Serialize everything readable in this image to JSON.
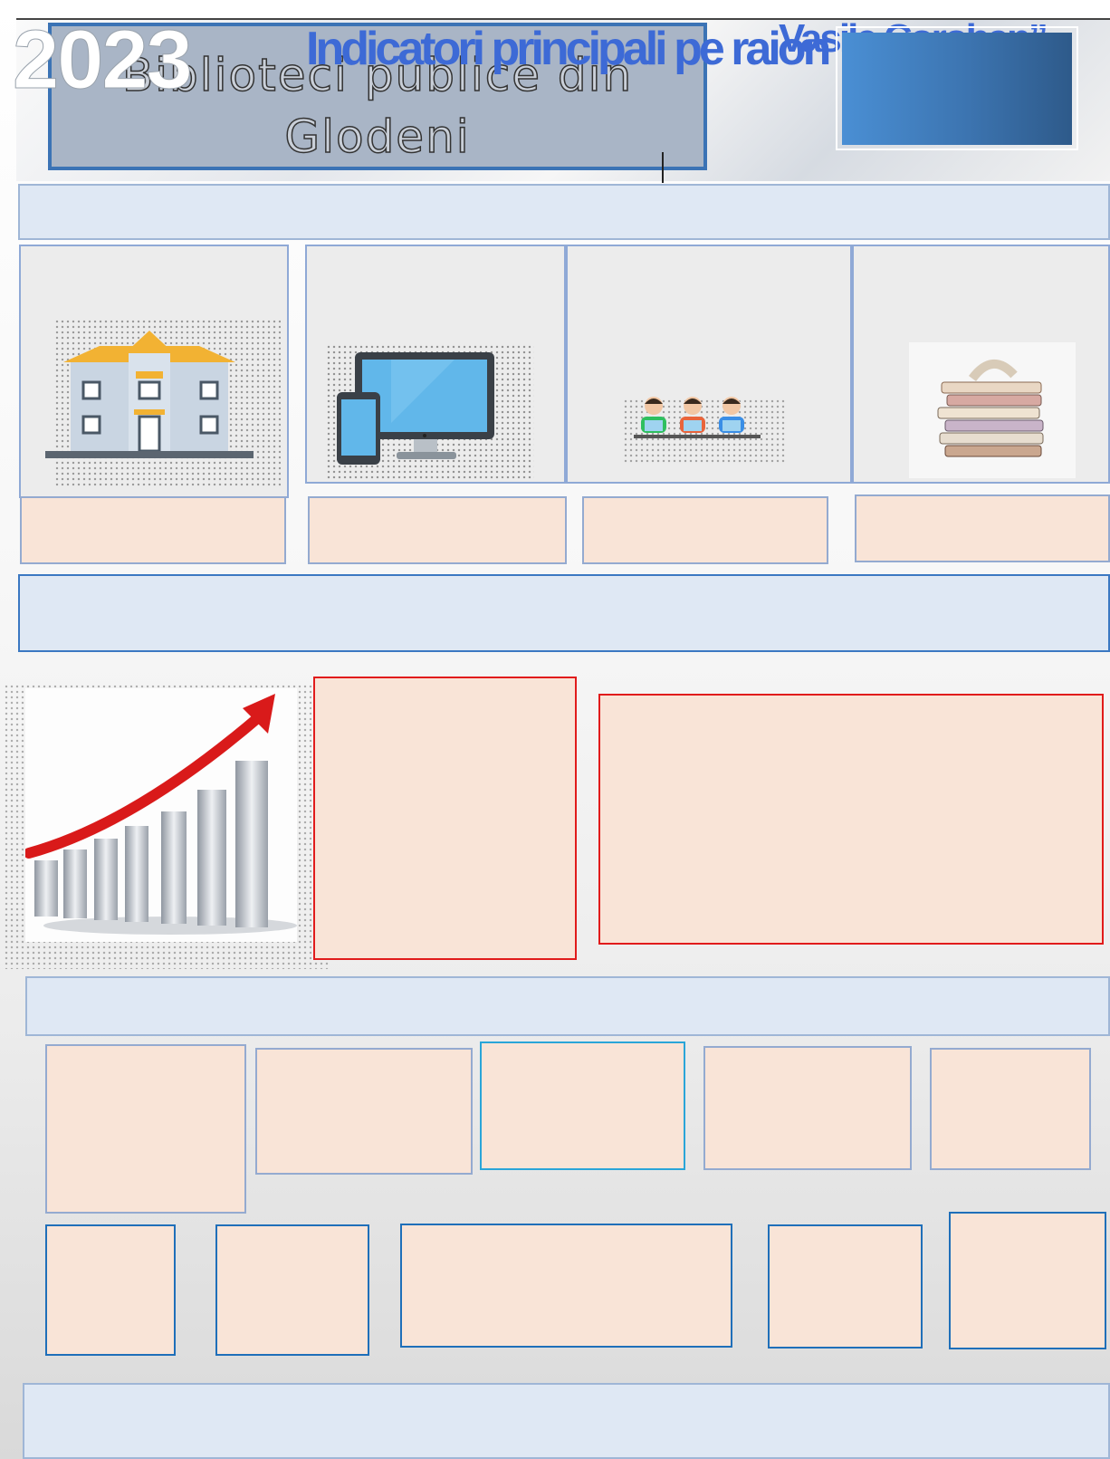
{
  "header": {
    "title": "Biblioteci publice din Glodeni",
    "year": "2023",
    "main_heading": "Indicatori principali pe raion",
    "quote_fragment": "Vasile Coroban”"
  },
  "colors": {
    "title_border": "#3b73b5",
    "panel_blue": "#3c74b0",
    "band_fill": "#dfe8f4",
    "card_fill": "#f9e4d7",
    "accent_red": "#e11b1b"
  },
  "icons": {
    "card1": "library-building-icon",
    "card2": "computer-devices-icon",
    "card3": "users-at-laptops-icon",
    "card4": "book-stack-icon",
    "growth": "growth-chart-arrow-icon"
  }
}
